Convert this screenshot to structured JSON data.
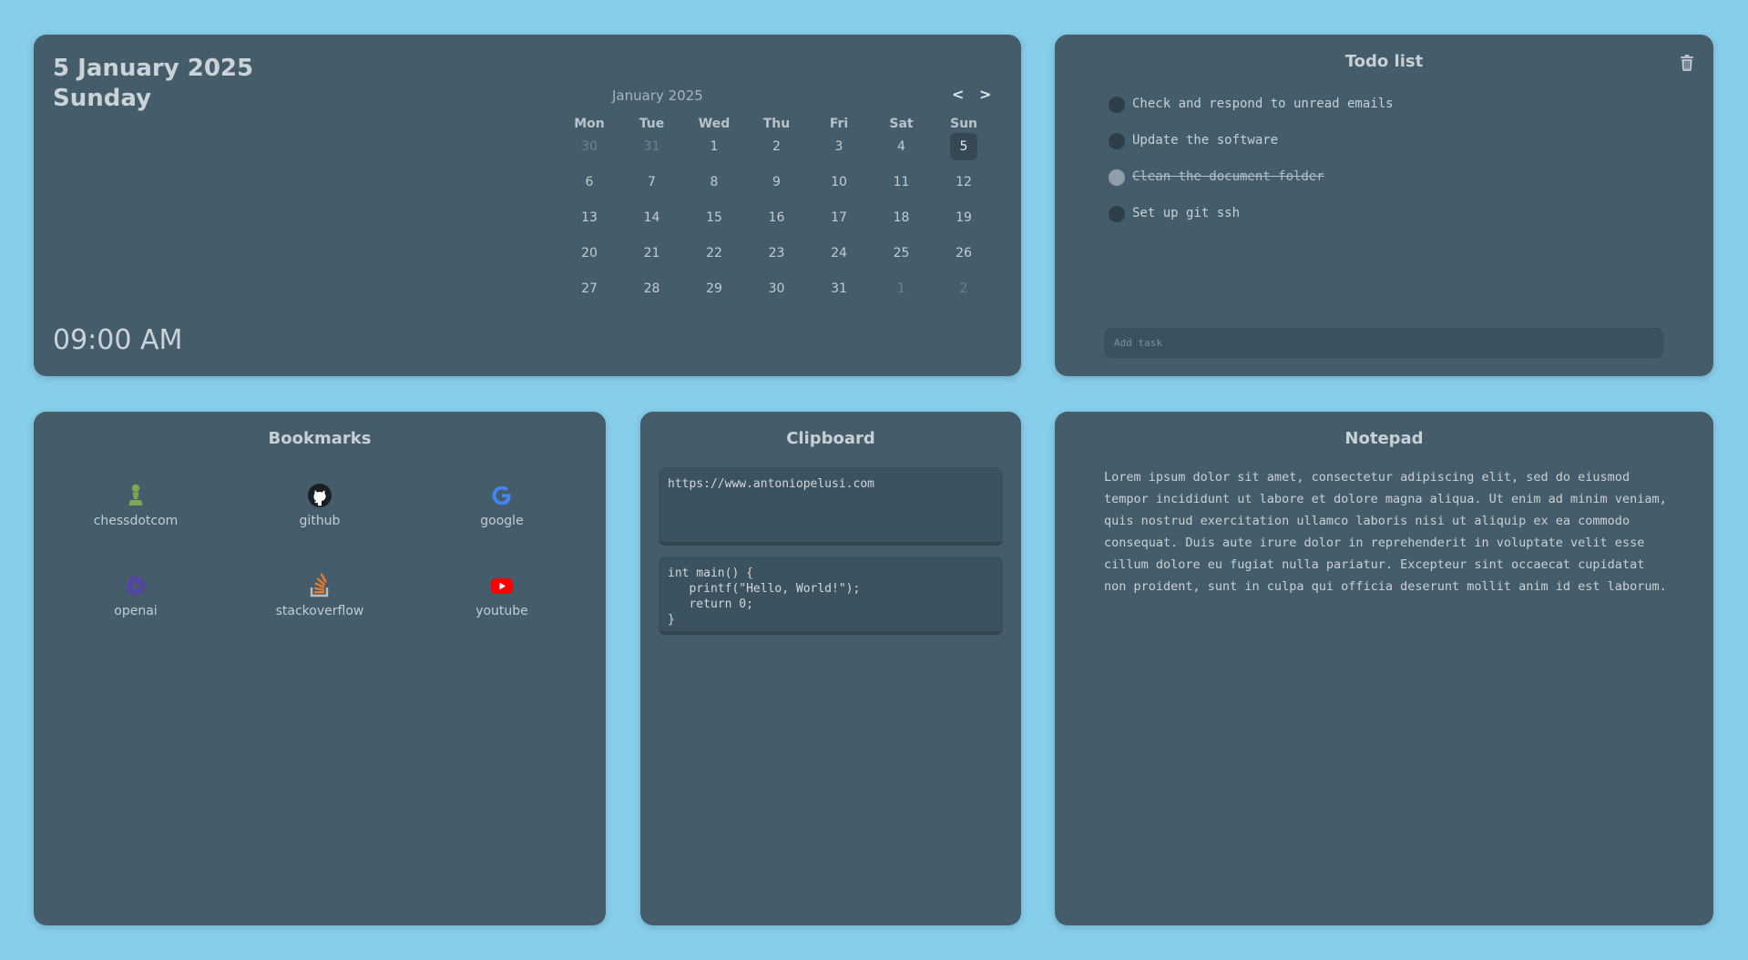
{
  "datetime": {
    "date": "5 January 2025",
    "weekday": "Sunday",
    "time": "09:00 AM"
  },
  "calendar": {
    "month_label": "January 2025",
    "prev_label": "<",
    "next_label": ">",
    "weekdays": [
      "Mon",
      "Tue",
      "Wed",
      "Thu",
      "Fri",
      "Sat",
      "Sun"
    ],
    "weeks": [
      [
        "30",
        "31",
        "1",
        "2",
        "3",
        "4",
        "5"
      ],
      [
        "6",
        "7",
        "8",
        "9",
        "10",
        "11",
        "12"
      ],
      [
        "13",
        "14",
        "15",
        "16",
        "17",
        "18",
        "19"
      ],
      [
        "20",
        "21",
        "22",
        "23",
        "24",
        "25",
        "26"
      ],
      [
        "27",
        "28",
        "29",
        "30",
        "31",
        "1",
        "2"
      ]
    ],
    "today": "5"
  },
  "todo": {
    "title": "Todo list",
    "trash_icon": "trash-icon",
    "items": [
      {
        "text": "Check and respond to unread emails",
        "done": false
      },
      {
        "text": "Update the software",
        "done": false
      },
      {
        "text": "Clean the document folder",
        "done": true
      },
      {
        "text": "Set up git ssh",
        "done": false
      }
    ],
    "input_placeholder": "Add task"
  },
  "bookmarks": {
    "title": "Bookmarks",
    "items": [
      {
        "label": "chessdotcom",
        "icon": "chess-pawn-icon",
        "color": "#7fa650"
      },
      {
        "label": "github",
        "icon": "github-icon",
        "color": "#1b1f23"
      },
      {
        "label": "google",
        "icon": "google-icon",
        "color": "#4285f4"
      },
      {
        "label": "openai",
        "icon": "openai-icon",
        "color": "#5a3fb0"
      },
      {
        "label": "stackoverflow",
        "icon": "stackoverflow-icon",
        "color": "#e87a2c"
      },
      {
        "label": "youtube",
        "icon": "youtube-icon",
        "color": "#ff0000"
      }
    ]
  },
  "clipboard": {
    "title": "Clipboard",
    "items": [
      "https://www.antoniopelusi.com",
      "int main() {\n   printf(\"Hello, World!\");\n   return 0;\n}"
    ]
  },
  "notepad": {
    "title": "Notepad",
    "text": "Lorem ipsum dolor sit amet, consectetur adipiscing elit, sed do eiusmod tempor incididunt ut labore et dolore magna aliqua. Ut enim ad minim veniam, quis nostrud exercitation ullamco laboris nisi ut aliquip ex ea commodo consequat. Duis aute irure dolor in reprehenderit in voluptate velit esse cillum dolore eu fugiat nulla pariatur. Excepteur sint occaecat cupidatat non proident, sunt in culpa qui officia deserunt mollit anim id est laborum."
  }
}
